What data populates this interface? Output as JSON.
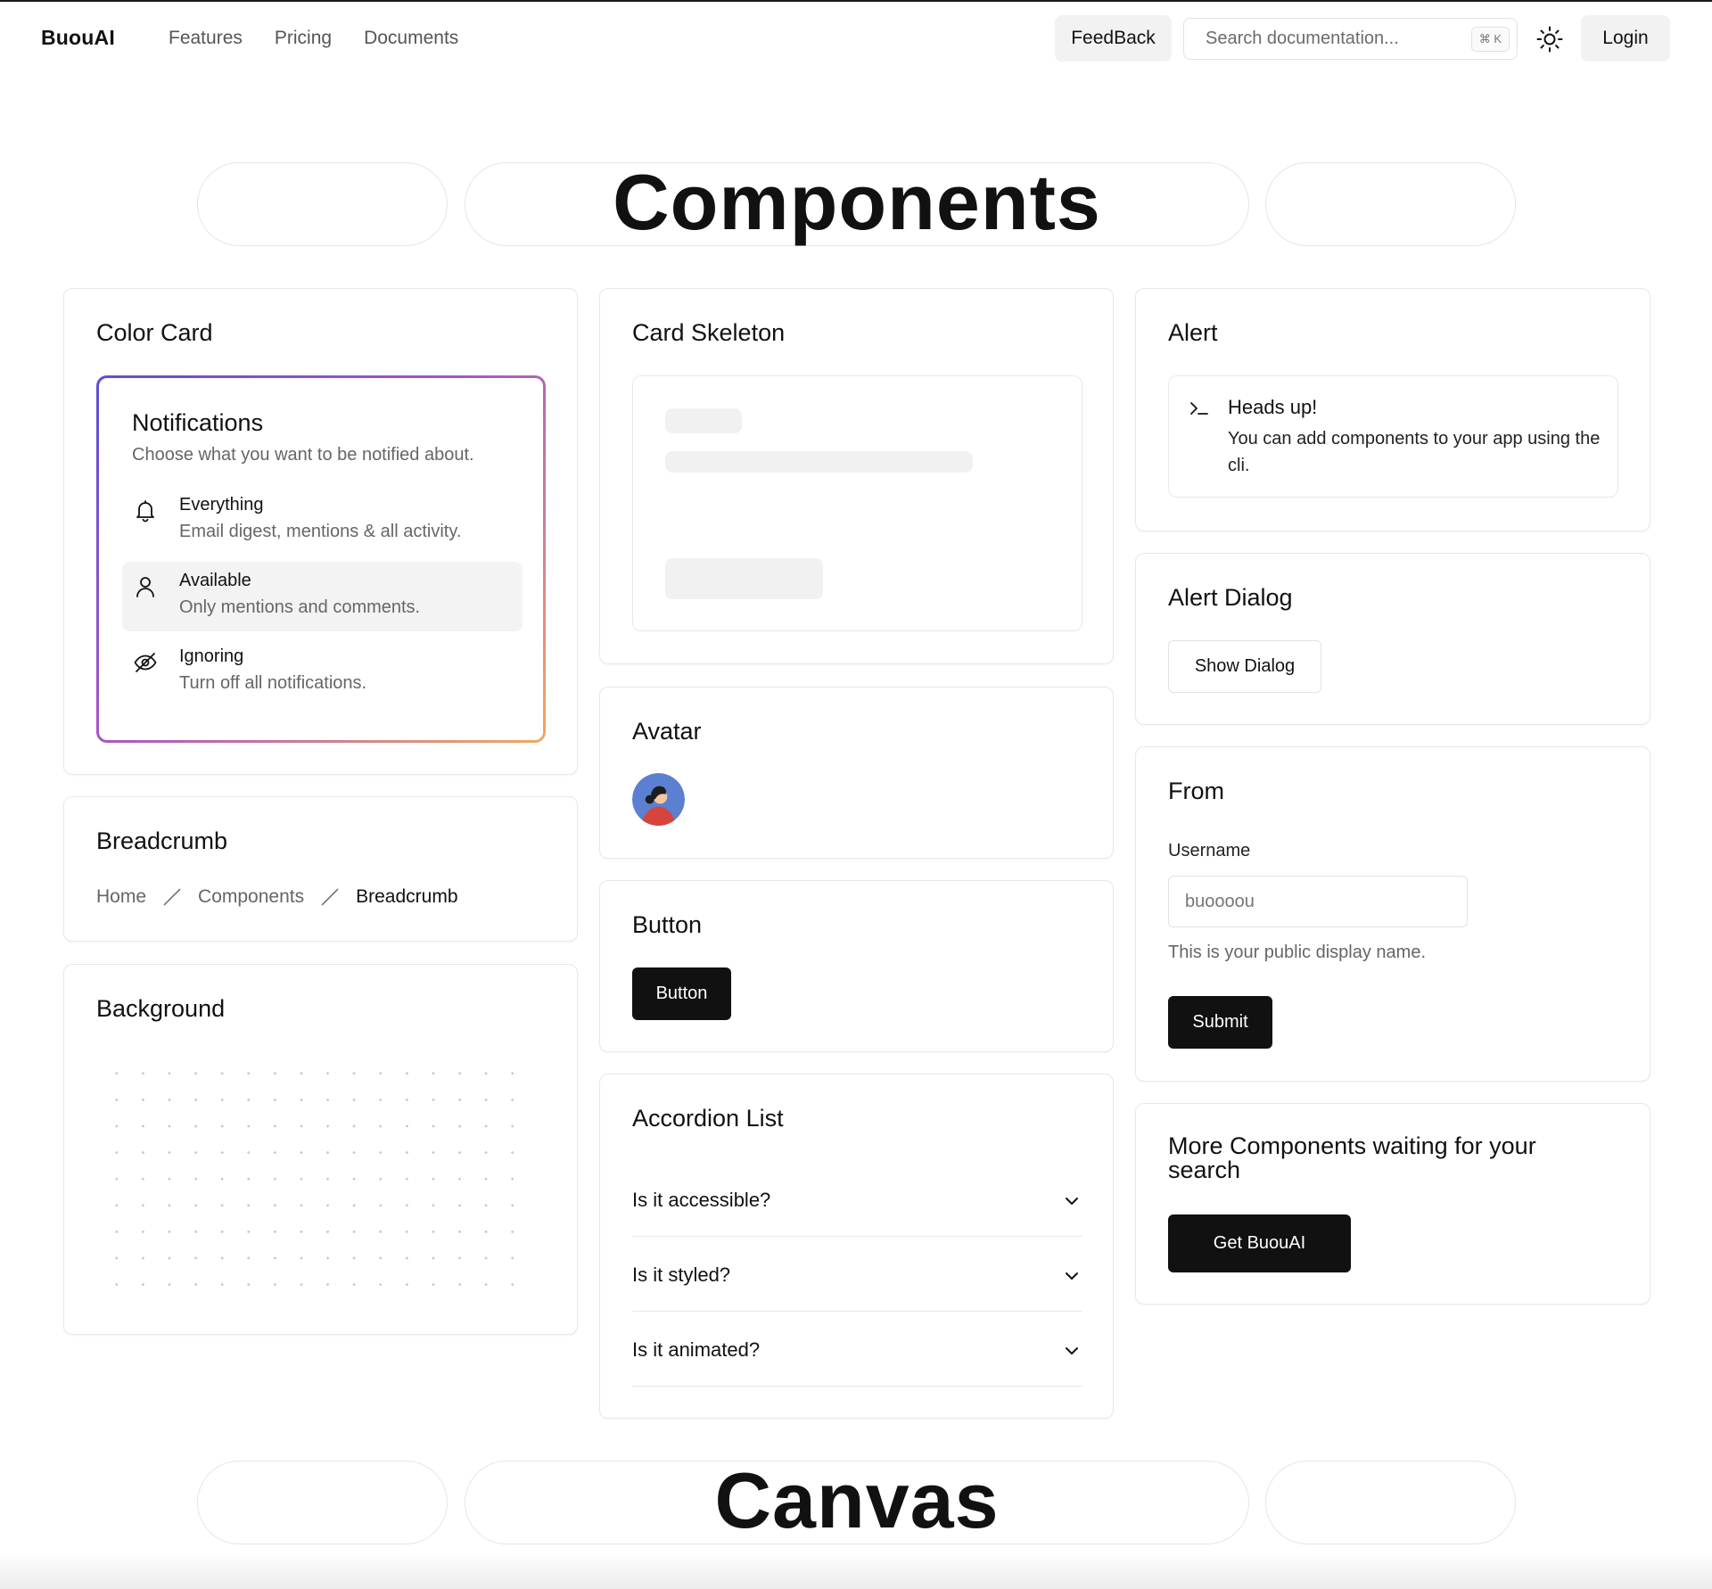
{
  "nav": {
    "brand": "BuouAI",
    "links": [
      "Features",
      "Pricing",
      "Documents"
    ],
    "feedback_label": "FeedBack",
    "search_placeholder": "Search documentation...",
    "search_shortcut": "⌘ K",
    "login_label": "Login",
    "theme_icon": "sun-icon"
  },
  "sections": {
    "components_title": "Components",
    "canvas_title": "Canvas"
  },
  "color_card": {
    "title": "Color Card",
    "panel_title": "Notifications",
    "panel_subtitle": "Choose what you want to be notified about.",
    "options": [
      {
        "title": "Everything",
        "desc": "Email digest, mentions & all activity.",
        "icon": "bell-icon"
      },
      {
        "title": "Available",
        "desc": "Only mentions and comments.",
        "icon": "user-icon"
      },
      {
        "title": "Ignoring",
        "desc": "Turn off all notifications.",
        "icon": "eye-off-icon"
      }
    ],
    "gradient": [
      "#5b4fd6",
      "#a855c7",
      "#f0a861"
    ]
  },
  "breadcrumb": {
    "title": "Breadcrumb",
    "items": [
      "Home",
      "Components",
      "Breadcrumb"
    ]
  },
  "background": {
    "title": "Background"
  },
  "card_skeleton": {
    "title": "Card Skeleton"
  },
  "avatar": {
    "title": "Avatar"
  },
  "button_card": {
    "title": "Button",
    "button_label": "Button"
  },
  "accordion": {
    "title": "Accordion List",
    "items": [
      "Is it accessible?",
      "Is it styled?",
      "Is it animated?"
    ]
  },
  "alert": {
    "title": "Alert",
    "heading": "Heads up!",
    "body": "You can add components to your app using the cli."
  },
  "alert_dialog": {
    "title": "Alert Dialog",
    "button_label": "Show Dialog"
  },
  "form": {
    "title": "From",
    "username_label": "Username",
    "username_placeholder": "buoooou",
    "hint": "This is your public display name.",
    "submit_label": "Submit"
  },
  "more": {
    "title": "More Components waiting for your search",
    "button_label": "Get BuouAI"
  },
  "colors": {
    "primary": "#111111",
    "muted": "#666666",
    "border": "#e8e8e8",
    "surface": "#f2f2f2"
  }
}
